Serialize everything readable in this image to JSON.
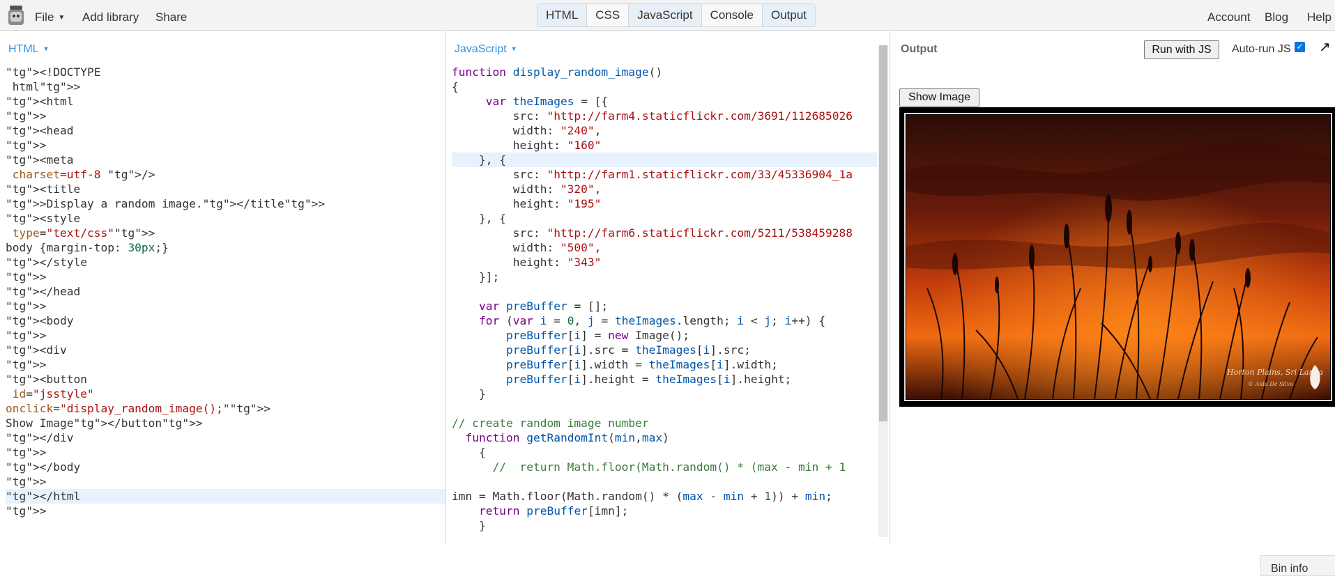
{
  "topbar": {
    "file": "File",
    "add_library": "Add library",
    "share": "Share",
    "tabs": [
      "HTML",
      "CSS",
      "JavaScript",
      "Console",
      "Output"
    ],
    "account": "Account",
    "blog": "Blog",
    "help": "Help"
  },
  "html_panel": {
    "label": "HTML",
    "lines": [
      "<!DOCTYPE html>",
      "<html>",
      "<head>",
      "<meta charset=utf-8 />",
      "<title>Display a random image.</title>",
      "<style type=\"text/css\">",
      "body {margin-top: 30px;}",
      "</style>",
      "</head>",
      "<body>",
      "<div>",
      "<button id=\"jsstyle\"",
      "onclick=\"display_random_image();\">Show Image</button>",
      "</div>",
      "</body>",
      "</html>"
    ]
  },
  "js_panel": {
    "label": "JavaScript",
    "lines": [
      "function display_random_image()",
      "{",
      "     var theImages = [{",
      "         src: \"http://farm4.staticflickr.com/3691/112685026",
      "         width: \"240\",",
      "         height: \"160\"",
      "    }, {",
      "         src: \"http://farm1.staticflickr.com/33/45336904_1a",
      "         width: \"320\",",
      "         height: \"195\"",
      "    }, {",
      "         src: \"http://farm6.staticflickr.com/5211/538459288",
      "         width: \"500\",",
      "         height: \"343\"",
      "    }];",
      "",
      "    var preBuffer = [];",
      "    for (var i = 0, j = theImages.length; i < j; i++) {",
      "        preBuffer[i] = new Image();",
      "        preBuffer[i].src = theImages[i].src;",
      "        preBuffer[i].width = theImages[i].width;",
      "        preBuffer[i].height = theImages[i].height;",
      "    }",
      "",
      "// create random image number",
      "  function getRandomInt(min,max)",
      "    {",
      "      //  return Math.floor(Math.random() * (max - min + 1",
      "",
      "imn = Math.floor(Math.random() * (max - min + 1)) + min;",
      "    return preBuffer[imn];",
      "    }"
    ]
  },
  "output_panel": {
    "title": "Output",
    "run_button": "Run with JS",
    "autorun_label": "Auto-run JS",
    "autorun_checked": true,
    "show_image_button": "Show Image",
    "image_caption": "Horton Plains, Sri Lanka",
    "image_credit": "© Aida De Silva",
    "bin_info": "Bin info"
  },
  "colors": {
    "accent": "#3b8fd6",
    "tag": "#9c2a8a",
    "string": "#a11111",
    "keyword": "#770088",
    "variable": "#0055aa",
    "number": "#116644",
    "comment": "#3b7a3b"
  }
}
